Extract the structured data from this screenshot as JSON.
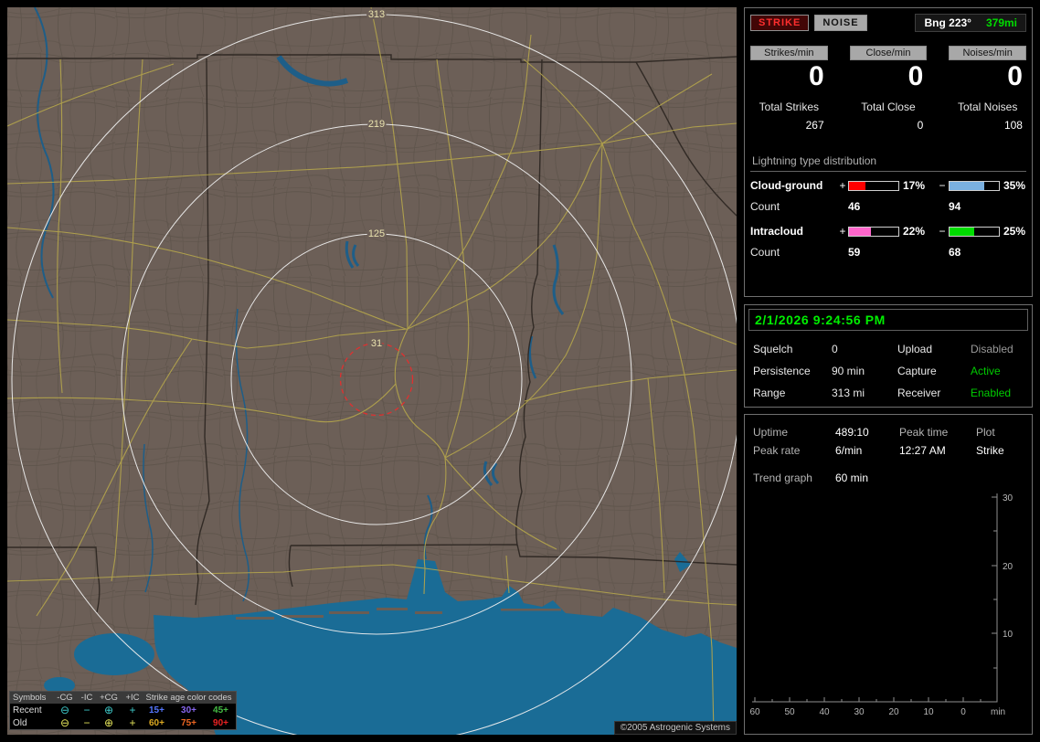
{
  "app": {
    "copyright": "©2005 Astrogenic Systems"
  },
  "map": {
    "rings": [
      {
        "label": "313"
      },
      {
        "label": "219"
      },
      {
        "label": "125"
      },
      {
        "label": "31"
      }
    ],
    "legend": {
      "symbols_header": "Symbols",
      "columns": [
        "-CG",
        "-IC",
        "+CG",
        "+IC"
      ],
      "age_header": "Strike age color codes",
      "recent": {
        "label": "Recent",
        "symbol_color": "#3ec9c9",
        "symbols": [
          "⊖",
          "−",
          "⊕",
          "+"
        ],
        "ages": [
          {
            "text": "15+",
            "color": "#5577ff"
          },
          {
            "text": "30+",
            "color": "#8866ee"
          },
          {
            "text": "45+",
            "color": "#44bb44"
          }
        ]
      },
      "old": {
        "label": "Old",
        "symbol_color": "#e3e35a",
        "symbols": [
          "⊖",
          "−",
          "⊕",
          "+"
        ],
        "ages": [
          {
            "text": "60+",
            "color": "#ddaa22"
          },
          {
            "text": "75+",
            "color": "#ee6622"
          },
          {
            "text": "90+",
            "color": "#ee2222"
          }
        ]
      }
    }
  },
  "panel": {
    "tabs": {
      "strike": "STRIKE",
      "noise": "NOISE"
    },
    "bearing": {
      "label": "Bng 223°",
      "distance": "379mi",
      "distance_color": "#00dd00"
    },
    "counters": [
      {
        "label": "Strikes/min",
        "value": "0",
        "total_label": "Total Strikes",
        "total": "267"
      },
      {
        "label": "Close/min",
        "value": "0",
        "total_label": "Total Close",
        "total": "0"
      },
      {
        "label": "Noises/min",
        "value": "0",
        "total_label": "Total Noises",
        "total": "108"
      }
    ],
    "distribution": {
      "title": "Lightning type distribution",
      "rows": [
        {
          "name": "Cloud-ground",
          "plus_sign": "+",
          "minus_sign": "−",
          "plus_pct": "17%",
          "plus_fill": "34%",
          "plus_color": "#ff0000",
          "minus_pct": "35%",
          "minus_fill": "70%",
          "minus_color": "#7ab0e0",
          "count_label": "Count",
          "plus_count": "46",
          "minus_count": "94"
        },
        {
          "name": "Intracloud",
          "plus_sign": "+",
          "minus_sign": "−",
          "plus_pct": "22%",
          "plus_fill": "44%",
          "plus_color": "#ff66cc",
          "minus_pct": "25%",
          "minus_fill": "50%",
          "minus_color": "#00dd00",
          "count_label": "Count",
          "plus_count": "59",
          "minus_count": "68"
        }
      ]
    },
    "status": {
      "datetime": "2/1/2026 9:24:56 PM",
      "rows": [
        {
          "l1": "Squelch",
          "v1": "0",
          "l2": "Upload",
          "v2": "Disabled",
          "v2_color": "#9a9a9a"
        },
        {
          "l1": "Persistence",
          "v1": "90 min",
          "l2": "Capture",
          "v2": "Active",
          "v2_color": "#00cc00"
        },
        {
          "l1": "Range",
          "v1": "313 mi",
          "l2": "Receiver",
          "v2": "Enabled",
          "v2_color": "#00cc00"
        }
      ]
    },
    "stats": {
      "uptime_label": "Uptime",
      "uptime": "489:10",
      "peak_time_label": "Peak time",
      "plot_label": "Plot",
      "peak_rate_label": "Peak rate",
      "peak_rate": "6/min",
      "peak_time": "12:27 AM",
      "plot": "Strike",
      "trend_label": "Trend graph",
      "trend_value": "60 min"
    },
    "trend_chart": {
      "y_ticks": [
        "30",
        "20",
        "10"
      ],
      "x_ticks": [
        "60",
        "50",
        "40",
        "30",
        "20",
        "10",
        "0"
      ],
      "x_unit": "min"
    }
  },
  "chart_data": {
    "type": "line",
    "title": "Trend graph (60 min window)",
    "xlabel": "min",
    "x_ticks": [
      60,
      50,
      40,
      30,
      20,
      10,
      0
    ],
    "y_ticks": [
      0,
      10,
      20,
      30
    ],
    "ylim": [
      0,
      30
    ],
    "series": [
      {
        "name": "Strike",
        "values": []
      }
    ],
    "note": "plot area empty - no data drawn"
  }
}
